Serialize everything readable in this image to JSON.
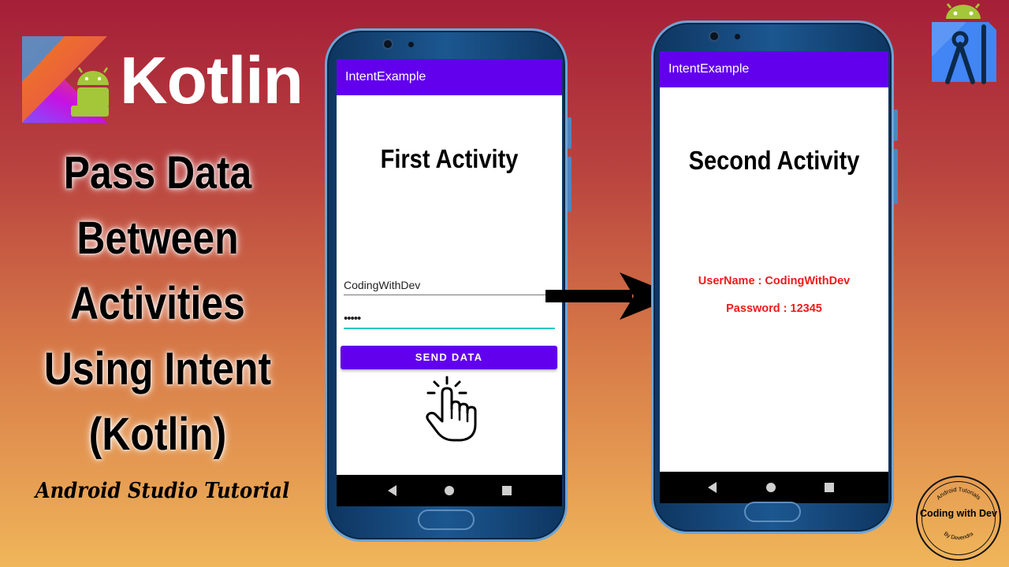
{
  "brand": {
    "kotlin_word": "Kotlin"
  },
  "title": {
    "lines": [
      "Pass Data",
      "Between",
      "Activities",
      "Using Intent",
      "(Kotlin)"
    ]
  },
  "subtitle": "Android Studio Tutorial",
  "first_phone": {
    "app_title": "IntentExample",
    "heading": "First Activity",
    "username_value": "CodingWithDev",
    "password_value": "•••••",
    "send_button_label": "SEND DATA"
  },
  "second_phone": {
    "app_title": "IntentExample",
    "heading": "Second Activity",
    "username_result": "UserName : CodingWithDev",
    "password_result": "Password : 12345"
  },
  "badge": {
    "main_text": "Coding with Dev",
    "ring_top": "Android Tutorials",
    "ring_bottom": "By Devendra"
  },
  "colors": {
    "app_bar": "#6200ee",
    "result_text": "#ef1a1a",
    "active_underline": "#1fc9c3",
    "kotlin_logo_gradient": [
      "#e44857",
      "#c711e1",
      "#7f52ff"
    ],
    "android_green": "#a4c639",
    "android_studio_blue": "#4285f4"
  },
  "icons": [
    "kotlin-logo-icon",
    "android-robot-icon",
    "android-studio-icon",
    "pointer-hand-icon",
    "arrow-right-icon",
    "nav-back-icon",
    "nav-home-icon",
    "nav-recents-icon"
  ]
}
